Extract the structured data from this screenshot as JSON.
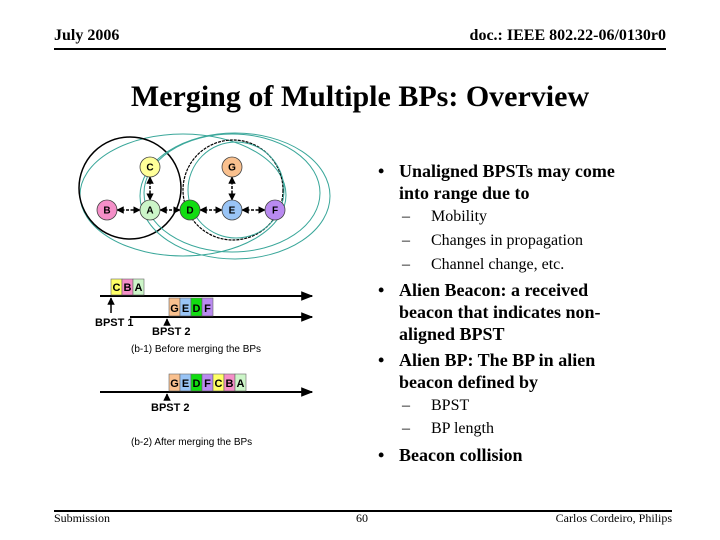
{
  "header": {
    "date": "July 2006",
    "doc_id": "doc.: IEEE 802.22-06/0130r0"
  },
  "title": "Merging of Multiple BPs: Overview",
  "diagram": {
    "nodes": [
      {
        "id": "C",
        "color": "#ffff99"
      },
      {
        "id": "G",
        "color": "#f9c08e"
      },
      {
        "id": "B",
        "color": "#f48fc8"
      },
      {
        "id": "A",
        "color": "#ccf5c8"
      },
      {
        "id": "D",
        "color": "#11dd11"
      },
      {
        "id": "E",
        "color": "#99c4f5"
      },
      {
        "id": "F",
        "color": "#b98af0"
      }
    ],
    "timeline_before": {
      "bp1_slots": [
        "C",
        "B",
        "A"
      ],
      "bp2_slots": [
        "G",
        "E",
        "D",
        "F"
      ],
      "bpst1_label": "BPST 1",
      "bpst2_label": "BPST 2",
      "caption": "(b-1) Before merging the BPs"
    },
    "timeline_after": {
      "slots": [
        "G",
        "E",
        "D",
        "F",
        "C",
        "B",
        "A"
      ],
      "bpst2_label": "BPST 2",
      "caption": "(b-2) After merging the BPs"
    },
    "slot_colors": {
      "A": "#ccf5c8",
      "B": "#f48fc8",
      "C": "#ffff66",
      "D": "#11dd11",
      "E": "#99c4f5",
      "F": "#b98af0",
      "G": "#f9c08e"
    }
  },
  "bullets": [
    {
      "text_lines": [
        "Unaligned BPSTs may come",
        "into range due to"
      ],
      "sub": [
        "Mobility",
        "Changes in propagation",
        "Channel change, etc."
      ]
    },
    {
      "text_lines": [
        "Alien Beacon: a received",
        "beacon that indicates non-",
        "aligned BPST"
      ],
      "sub": []
    },
    {
      "text_lines": [
        "Alien BP: The BP in alien",
        "beacon defined by"
      ],
      "sub": [
        "BPST",
        "BP length"
      ]
    },
    {
      "text_lines": [
        "Beacon collision"
      ],
      "sub": []
    }
  ],
  "bullet_glyph": "•",
  "dash_glyph": "–",
  "footer": {
    "left": "Submission",
    "page": "60",
    "right": "Carlos Cordeiro, Philips"
  }
}
